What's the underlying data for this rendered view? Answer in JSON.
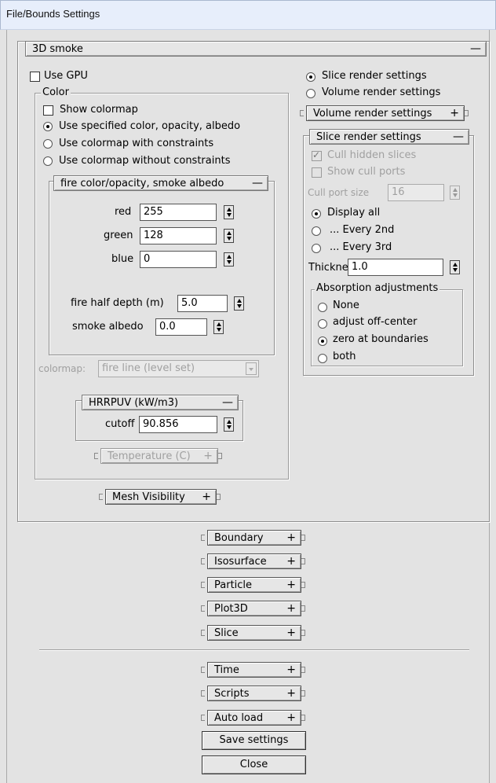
{
  "window": {
    "title": "File/Bounds Settings"
  },
  "smoke": {
    "header": "3D smoke",
    "toggle": "—",
    "use_gpu": "Use GPU",
    "color_group": "Color",
    "show_colormap": "Show colormap",
    "opt_specified": "Use specified color, opacity, albedo",
    "opt_constraints": "Use colormap with constraints",
    "opt_no_constraints": "Use colormap without constraints",
    "fire_panel": "fire color/opacity, smoke albedo",
    "fire_toggle": "—",
    "red_label": "red",
    "red_value": "255",
    "green_label": "green",
    "green_value": "128",
    "blue_label": "blue",
    "blue_value": "0",
    "half_depth_label": "fire half depth (m)",
    "half_depth_value": "5.0",
    "albedo_label": "smoke albedo",
    "albedo_value": "0.0",
    "colormap_label": "colormap:",
    "colormap_value": "fire line (level set)",
    "hrrpuv_header": "HRRPUV (kW/m3)",
    "hrrpuv_toggle": "—",
    "cutoff_label": "cutoff",
    "cutoff_value": "90.856",
    "temperature": "Temperature (C)",
    "temperature_toggle": "+",
    "mesh_visibility": "Mesh Visibility",
    "mesh_toggle": "+"
  },
  "render": {
    "slice_radio": "Slice render settings",
    "volume_radio": "Volume render settings",
    "volume_panel": "Volume render settings",
    "volume_toggle": "+",
    "slice_panel": "Slice render settings",
    "slice_toggle": "—",
    "cull_hidden": "Cull hidden slices",
    "show_cull_ports": "Show cull ports",
    "cull_port_size_label": "Cull port size",
    "cull_port_size_value": "16",
    "display_all": "Display all",
    "every_2nd": "... Every 2nd",
    "every_3rd": "... Every 3rd",
    "thickness_label": "Thickness",
    "thickness_value": "1.0",
    "absorption_group": "Absorption adjustments",
    "abs_none": "None",
    "abs_off_center": "adjust off-center",
    "abs_zero": "zero at boundaries",
    "abs_both": "both"
  },
  "sections": [
    {
      "label": "Boundary",
      "toggle": "+"
    },
    {
      "label": "Isosurface",
      "toggle": "+"
    },
    {
      "label": "Particle",
      "toggle": "+"
    },
    {
      "label": "Plot3D",
      "toggle": "+"
    },
    {
      "label": "Slice",
      "toggle": "+"
    }
  ],
  "bottom": [
    {
      "label": "Time",
      "toggle": "+"
    },
    {
      "label": "Scripts",
      "toggle": "+"
    },
    {
      "label": "Auto load",
      "toggle": "+"
    }
  ],
  "buttons": {
    "save": "Save settings",
    "close": "Close"
  }
}
